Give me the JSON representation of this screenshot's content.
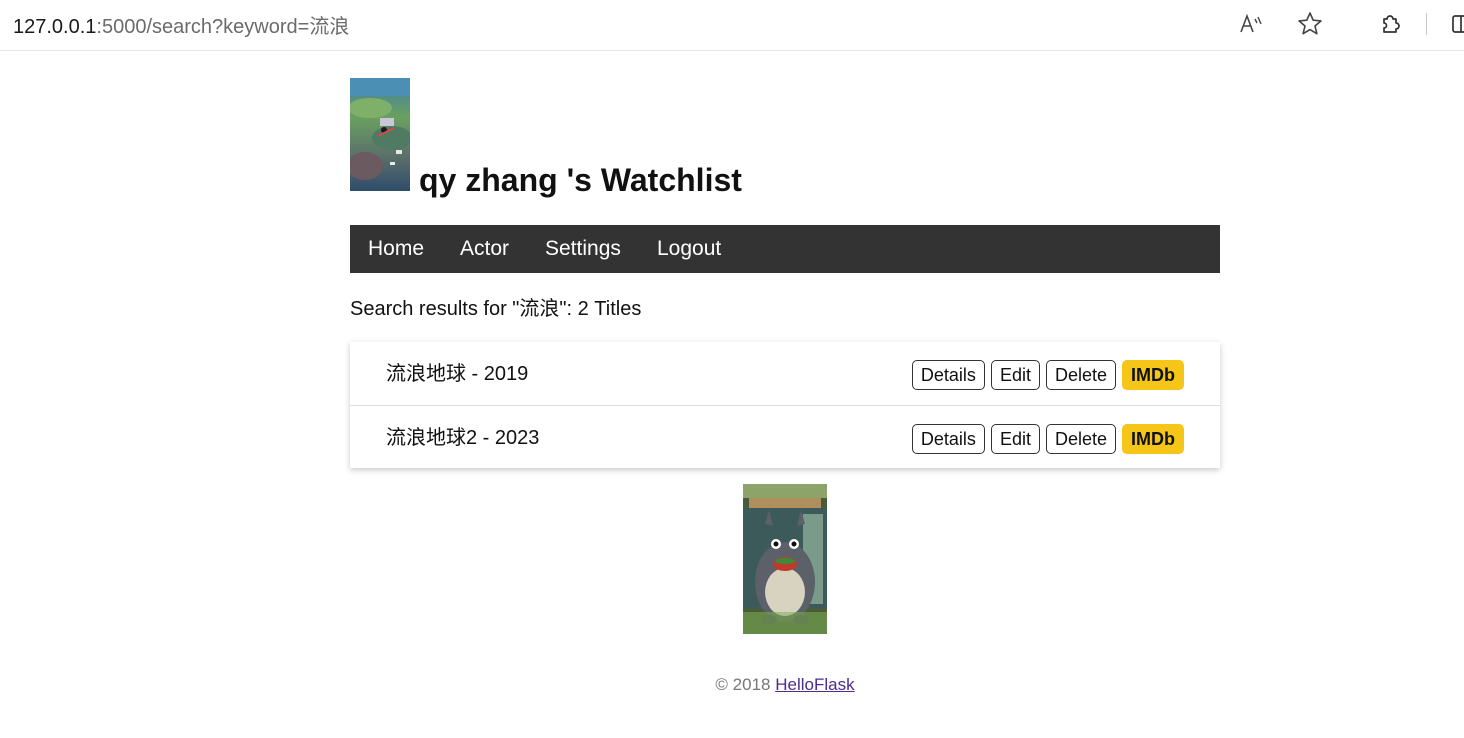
{
  "browser": {
    "url_host": "127.0.0.1",
    "url_rest": ":5000/search?keyword=流浪",
    "icons": [
      "read-aloud-icon",
      "favorite-star-icon",
      "extensions-icon",
      "split-screen-icon"
    ]
  },
  "header": {
    "title": "qy zhang 's Watchlist",
    "avatar_icon": "avatar-image"
  },
  "nav": {
    "items": [
      {
        "label": "Home"
      },
      {
        "label": "Actor"
      },
      {
        "label": "Settings"
      },
      {
        "label": "Logout"
      }
    ]
  },
  "search": {
    "result_text": "Search results for \"流浪\": 2 Titles"
  },
  "movies": [
    {
      "title": "流浪地球 - 2019",
      "details": "Details",
      "edit": "Edit",
      "delete": "Delete",
      "imdb": "IMDb"
    },
    {
      "title": "流浪地球2 - 2023",
      "details": "Details",
      "edit": "Edit",
      "delete": "Delete",
      "imdb": "IMDb"
    }
  ],
  "footer": {
    "copyright": "© 2018",
    "link_text": "HelloFlask"
  },
  "colors": {
    "nav_bg": "#333333",
    "imdb": "#f5c518",
    "link": "#4b2c8f"
  }
}
